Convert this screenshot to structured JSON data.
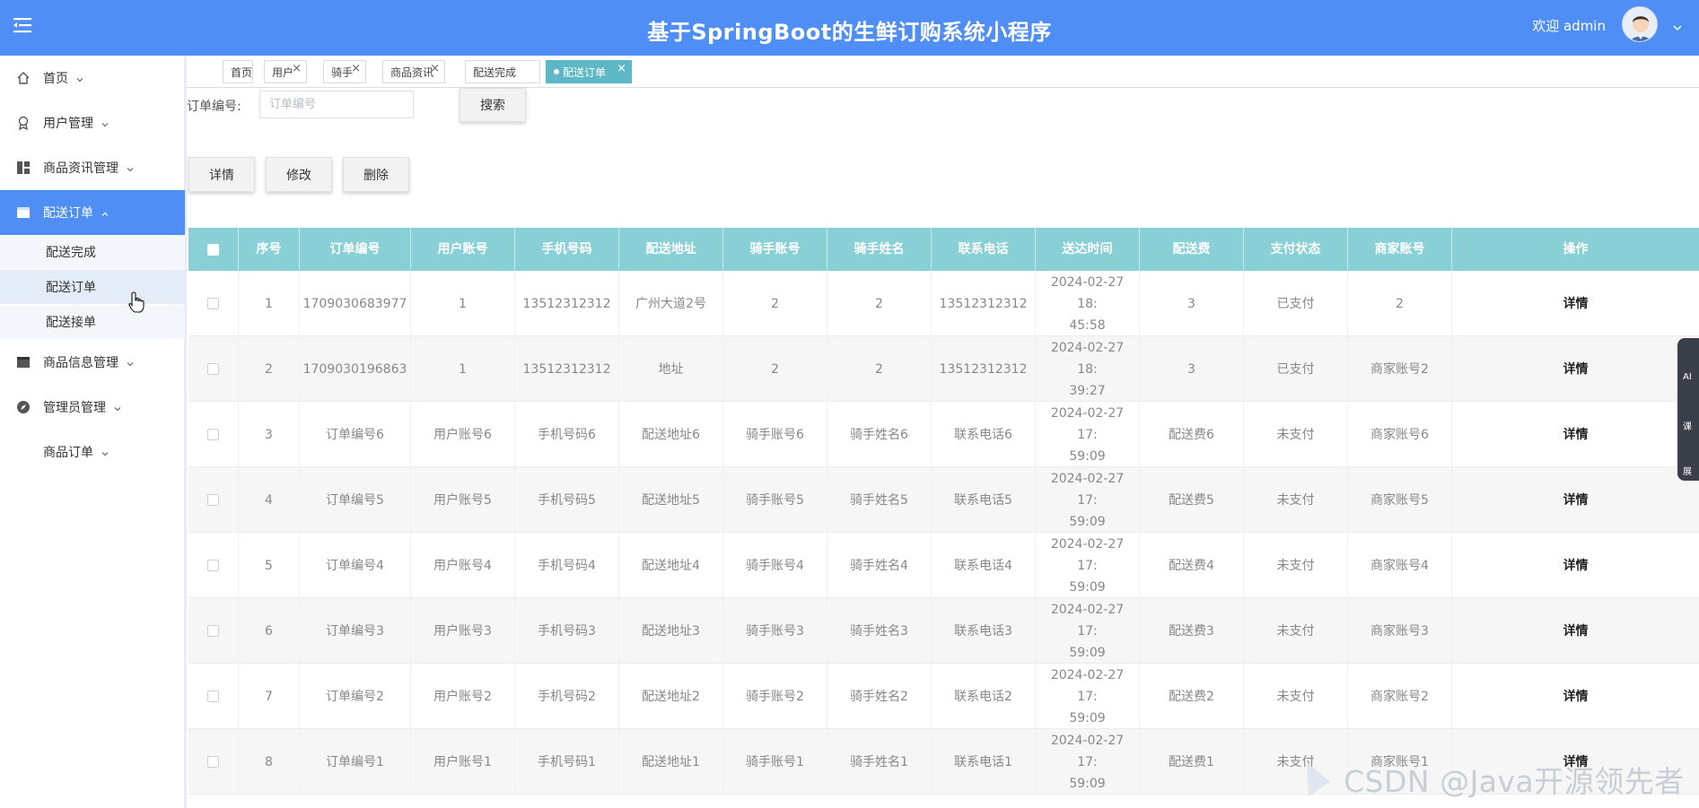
{
  "header": {
    "title": "基于SpringBoot的生鲜订购系统小程序",
    "welcome": "欢迎 admin",
    "bg_color": "#4f8ef5"
  },
  "sidebar": {
    "items": [
      {
        "label": "首页",
        "icon": "home-icon"
      },
      {
        "label": "用户管理",
        "icon": "badge-icon"
      },
      {
        "label": "商品资讯管理",
        "icon": "dashboard-icon"
      },
      {
        "label": "配送订单",
        "icon": "window-icon",
        "active": true
      },
      {
        "label": "商品信息管理",
        "icon": "window-icon"
      },
      {
        "label": "管理员管理",
        "icon": "compass-icon"
      },
      {
        "label": "商品订单",
        "icon": ""
      }
    ],
    "sub_items": [
      "配送完成",
      "配送订单",
      "配送接单"
    ]
  },
  "tabs": [
    {
      "label": "首页"
    },
    {
      "label": "用户"
    },
    {
      "label": "骑手"
    },
    {
      "label": "商品资讯"
    },
    {
      "label": "配送完成"
    },
    {
      "label": "配送订单",
      "active": true
    }
  ],
  "tab_close": "×",
  "search": {
    "label": "订单编号:",
    "placeholder": "订单编号",
    "button": "搜索"
  },
  "actions": {
    "detail": "详情",
    "edit": "修改",
    "delete": "删除"
  },
  "table": {
    "columns": [
      "序号",
      "订单编号",
      "用户账号",
      "手机号码",
      "配送地址",
      "骑手账号",
      "骑手姓名",
      "联系电话",
      "送达时间",
      "配送费",
      "支付状态",
      "商家账号",
      "操作"
    ],
    "rows": [
      {
        "no": "1",
        "order": "1709030683977",
        "user": "1",
        "phone": "13512312312",
        "addr": "广州大道2号",
        "rider": "2",
        "rider_name": "2",
        "contact": "13512312312",
        "time1": "2024-02-27 18:",
        "time2": "45:58",
        "fee": "3",
        "pay": "已支付",
        "merchant": "2",
        "op": "详情"
      },
      {
        "no": "2",
        "order": "1709030196863",
        "user": "1",
        "phone": "13512312312",
        "addr": "地址",
        "rider": "2",
        "rider_name": "2",
        "contact": "13512312312",
        "time1": "2024-02-27 18:",
        "time2": "39:27",
        "fee": "3",
        "pay": "已支付",
        "merchant": "商家账号2",
        "op": "详情"
      },
      {
        "no": "3",
        "order": "订单编号6",
        "user": "用户账号6",
        "phone": "手机号码6",
        "addr": "配送地址6",
        "rider": "骑手账号6",
        "rider_name": "骑手姓名6",
        "contact": "联系电话6",
        "time1": "2024-02-27 17:",
        "time2": "59:09",
        "fee": "配送费6",
        "pay": "未支付",
        "merchant": "商家账号6",
        "op": "详情"
      },
      {
        "no": "4",
        "order": "订单编号5",
        "user": "用户账号5",
        "phone": "手机号码5",
        "addr": "配送地址5",
        "rider": "骑手账号5",
        "rider_name": "骑手姓名5",
        "contact": "联系电话5",
        "time1": "2024-02-27 17:",
        "time2": "59:09",
        "fee": "配送费5",
        "pay": "未支付",
        "merchant": "商家账号5",
        "op": "详情"
      },
      {
        "no": "5",
        "order": "订单编号4",
        "user": "用户账号4",
        "phone": "手机号码4",
        "addr": "配送地址4",
        "rider": "骑手账号4",
        "rider_name": "骑手姓名4",
        "contact": "联系电话4",
        "time1": "2024-02-27 17:",
        "time2": "59:09",
        "fee": "配送费4",
        "pay": "未支付",
        "merchant": "商家账号4",
        "op": "详情"
      },
      {
        "no": "6",
        "order": "订单编号3",
        "user": "用户账号3",
        "phone": "手机号码3",
        "addr": "配送地址3",
        "rider": "骑手账号3",
        "rider_name": "骑手姓名3",
        "contact": "联系电话3",
        "time1": "2024-02-27 17:",
        "time2": "59:09",
        "fee": "配送费3",
        "pay": "未支付",
        "merchant": "商家账号3",
        "op": "详情"
      },
      {
        "no": "7",
        "order": "订单编号2",
        "user": "用户账号2",
        "phone": "手机号码2",
        "addr": "配送地址2",
        "rider": "骑手账号2",
        "rider_name": "骑手姓名2",
        "contact": "联系电话2",
        "time1": "2024-02-27 17:",
        "time2": "59:09",
        "fee": "配送费2",
        "pay": "未支付",
        "merchant": "商家账号2",
        "op": "详情"
      },
      {
        "no": "8",
        "order": "订单编号1",
        "user": "用户账号1",
        "phone": "手机号码1",
        "addr": "配送地址1",
        "rider": "骑手账号1",
        "rider_name": "骑手姓名1",
        "contact": "联系电话1",
        "time1": "2024-02-27 17:",
        "time2": "59:09",
        "fee": "配送费1",
        "pay": "未支付",
        "merchant": "商家账号1",
        "op": "详情"
      }
    ]
  },
  "float_bar": [
    "AI",
    "课",
    "展"
  ],
  "watermark": "CSDN @Java开源领先者",
  "colors": {
    "table_header": "#88cfd6",
    "active_tab": "#5db7c4",
    "active_nav": "#4f8ef5"
  }
}
